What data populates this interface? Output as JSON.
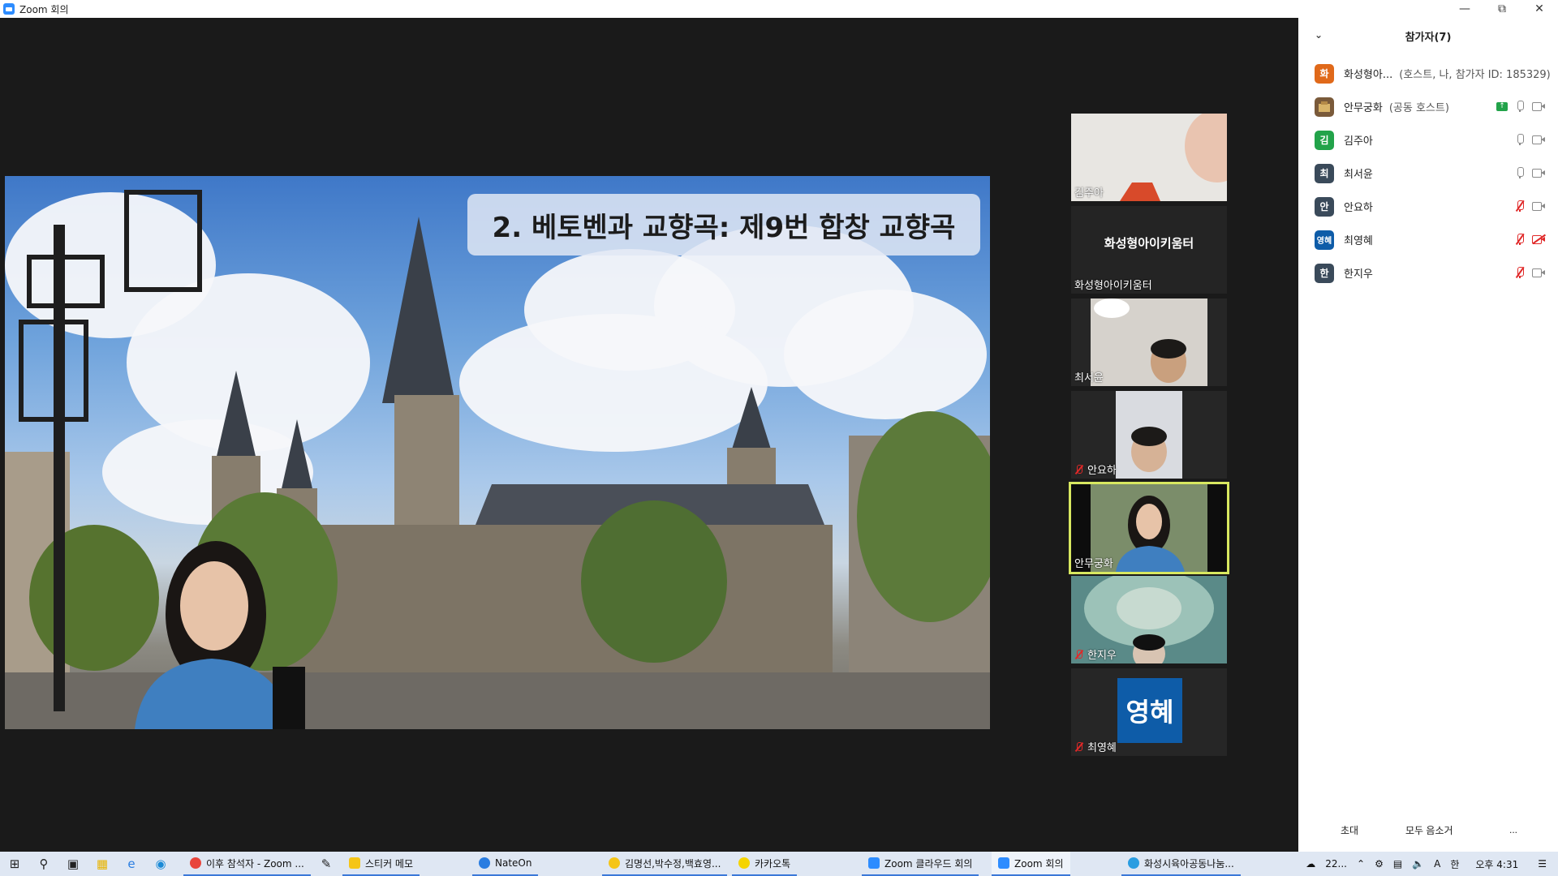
{
  "window": {
    "title": "Zoom 회의"
  },
  "slide": {
    "title": "2. 베토벤과 교향곡: 제9번 합창 교향곡"
  },
  "gallery": [
    {
      "name": "김주아",
      "muted": false
    },
    {
      "name": "화성형아이키움터",
      "center_label": "화성형아이키움터",
      "muted": false
    },
    {
      "name": "최서윤",
      "muted": false
    },
    {
      "name": "안요하",
      "muted": true
    },
    {
      "name": "안무궁화",
      "muted": false,
      "active": true
    },
    {
      "name": "한지우",
      "muted": true
    },
    {
      "name": "최영혜",
      "avatar_text": "영혜",
      "muted": true
    }
  ],
  "panel": {
    "title": "참가자(7)",
    "participants": [
      {
        "initial": "화",
        "name": "화성형아...",
        "role": "(호스트, 나, 참가자 ID: 185329)",
        "color": "#e0691a"
      },
      {
        "initial": "",
        "name": "안무궁화",
        "role": "(공동 호스트)",
        "color": "#7a5a3a",
        "sharing": true
      },
      {
        "initial": "김",
        "name": "김주아",
        "role": "",
        "color": "#22a34a"
      },
      {
        "initial": "최",
        "name": "최서윤",
        "role": "",
        "color": "#3a4a5a"
      },
      {
        "initial": "안",
        "name": "안요하",
        "role": "",
        "color": "#3a4a5a",
        "mic_muted": true
      },
      {
        "initial": "영혜",
        "name": "최영혜",
        "role": "",
        "color": "#0e5ca8",
        "mic_muted": true,
        "cam_off": true
      },
      {
        "initial": "한",
        "name": "한지우",
        "role": "",
        "color": "#3a4a5a",
        "mic_muted": true
      }
    ],
    "footer": {
      "invite": "초대",
      "mute_all": "모두 음소거",
      "more": "..."
    }
  },
  "taskbar": {
    "apps": [
      {
        "label": "이후 참석자 - Zoom ...",
        "color": "#e8453c"
      },
      {
        "label": "스티커 메모",
        "color": "#f5c518"
      },
      {
        "label": "NateOn",
        "color": "#2a7de1"
      },
      {
        "label": "김명선,박수정,백효영...",
        "color": "#f5c518"
      },
      {
        "label": "카카오톡",
        "color": "#f5d400"
      },
      {
        "label": "Zoom 클라우드 회의",
        "color": "#2D8CFF"
      },
      {
        "label": "Zoom 회의",
        "color": "#2D8CFF"
      },
      {
        "label": "화성시육아공동나눔...",
        "color": "#2a9de1"
      }
    ],
    "tray": {
      "temp": "22...",
      "ime": "한",
      "time": "오후 4:31"
    }
  }
}
